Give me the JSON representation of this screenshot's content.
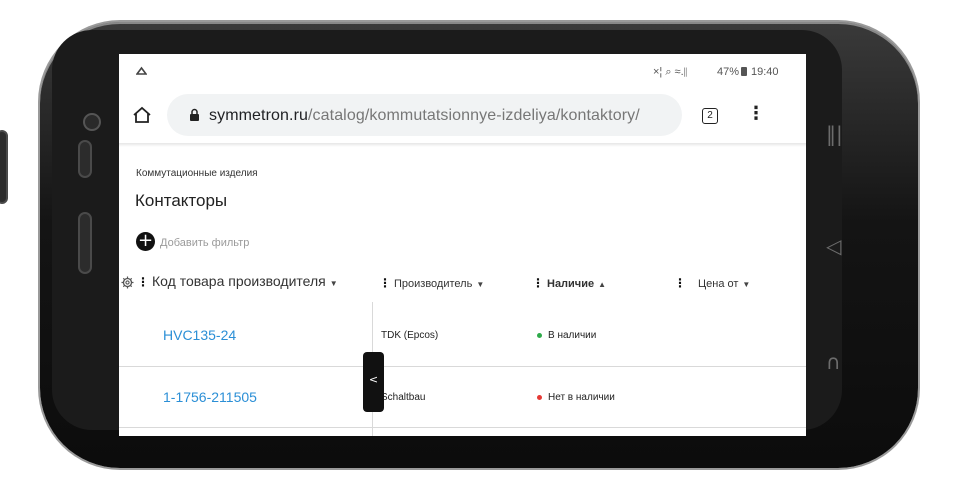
{
  "status_bar": {
    "indicators": "×¦ ⌕ ≈.∥",
    "battery": "47%",
    "time": "19:40"
  },
  "browser": {
    "url_host": "symmetron.ru",
    "url_path": "/catalog/kommutatsionnye-izdeliya/kontaktory/",
    "tab_count": "2",
    "home_icon": "home-icon",
    "lock_icon": "lock-icon",
    "menu_icon": "more-vert-icon"
  },
  "page": {
    "breadcrumb": "Коммутационные изделия",
    "title": "Контакторы",
    "add_filter": "Добавить фильтр"
  },
  "table": {
    "columns": [
      {
        "label": "Код товара производителя",
        "sort": "▼"
      },
      {
        "label": "Производитель",
        "sort": "▼"
      },
      {
        "label": "Наличие",
        "sort": "▲"
      },
      {
        "label": "Цена от",
        "sort": "▼"
      }
    ],
    "rows": [
      {
        "code": "HVC135-24",
        "manufacturer": "TDK (Epcos)",
        "availability": "В наличии",
        "status_color": "#2eaa4a"
      },
      {
        "code": "1-1756-211505",
        "manufacturer": "Schaltbau",
        "availability": "Нет в наличии",
        "status_color": "#e53935"
      }
    ],
    "scroll_handle": "<"
  },
  "colors": {
    "link": "#2b8fd6",
    "in_stock": "#2eaa4a",
    "out_of_stock": "#e53935"
  }
}
